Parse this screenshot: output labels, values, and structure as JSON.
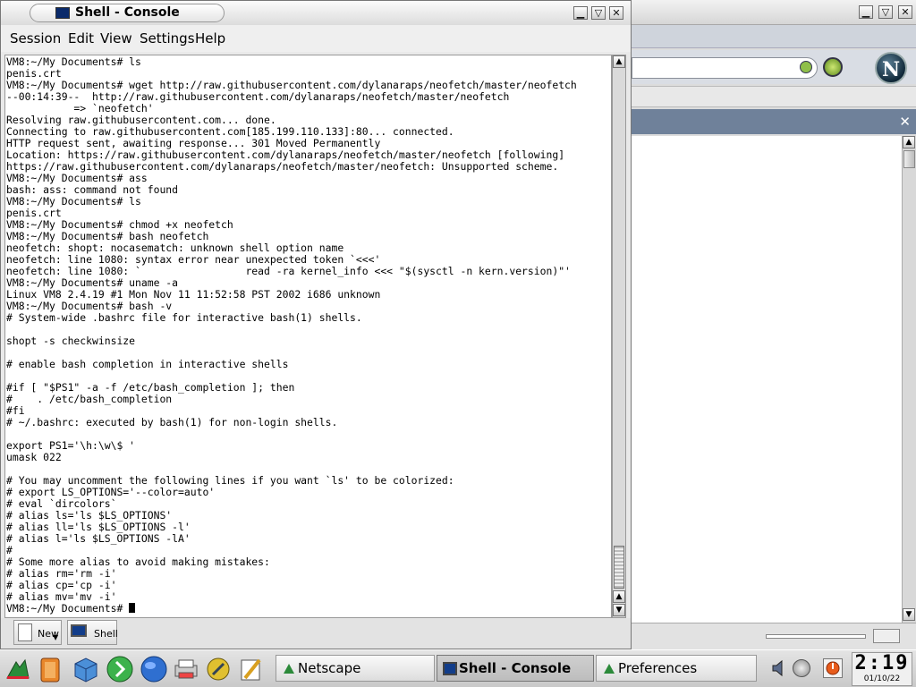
{
  "console_window": {
    "title": "Shell - Console",
    "menu": [
      "Session",
      "Edit",
      "View",
      "Settings",
      "Help"
    ],
    "terminal_lines": [
      "VM8:~/My Documents# ls",
      "penis.crt",
      "VM8:~/My Documents# wget http://raw.githubusercontent.com/dylanaraps/neofetch/master/neofetch",
      "--00:14:39--  http://raw.githubusercontent.com/dylanaraps/neofetch/master/neofetch",
      "           => `neofetch'",
      "Resolving raw.githubusercontent.com... done.",
      "Connecting to raw.githubusercontent.com[185.199.110.133]:80... connected.",
      "HTTP request sent, awaiting response... 301 Moved Permanently",
      "Location: https://raw.githubusercontent.com/dylanaraps/neofetch/master/neofetch [following]",
      "https://raw.githubusercontent.com/dylanaraps/neofetch/master/neofetch: Unsupported scheme.",
      "VM8:~/My Documents# ass",
      "bash: ass: command not found",
      "VM8:~/My Documents# ls",
      "penis.crt",
      "VM8:~/My Documents# chmod +x neofetch",
      "VM8:~/My Documents# bash neofetch",
      "neofetch: shopt: nocasematch: unknown shell option name",
      "neofetch: line 1080: syntax error near unexpected token `<<<'",
      "neofetch: line 1080: `                 read -ra kernel_info <<< \"$(sysctl -n kern.version)\"'",
      "VM8:~/My Documents# uname -a",
      "Linux VM8 2.4.19 #1 Mon Nov 11 11:52:58 PST 2002 i686 unknown",
      "VM8:~/My Documents# bash -v",
      "# System-wide .bashrc file for interactive bash(1) shells.",
      "",
      "shopt -s checkwinsize",
      "",
      "# enable bash completion in interactive shells",
      "",
      "#if [ \"$PS1\" -a -f /etc/bash_completion ]; then",
      "#    . /etc/bash_completion",
      "#fi",
      "# ~/.bashrc: executed by bash(1) for non-login shells.",
      "",
      "export PS1='\\h:\\w\\$ '",
      "umask 022",
      "",
      "# You may uncomment the following lines if you want `ls' to be colorized:",
      "# export LS_OPTIONS='--color=auto'",
      "# eval `dircolors`",
      "# alias ls='ls $LS_OPTIONS'",
      "# alias ll='ls $LS_OPTIONS -l'",
      "# alias l='ls $LS_OPTIONS -lA'",
      "#",
      "# Some more alias to avoid making mistakes:",
      "# alias rm='rm -i'",
      "# alias cp='cp -i'",
      "# alias mv='mv -i'"
    ],
    "prompt": "VM8:~/My Documents# ",
    "tabs": [
      {
        "label": "New",
        "icon": "new-document-icon"
      },
      {
        "label": "Shell",
        "icon": "terminal-icon"
      }
    ]
  },
  "taskbar": {
    "launchers": [
      "kde-menu-icon",
      "lifebuoy-help-icon",
      "home-cube-icon",
      "runner-icon",
      "globe-icon",
      "printer-icon",
      "tools-icon",
      "editor-icon"
    ],
    "tasks": [
      {
        "label": "Netscape",
        "icon": "netscape-icon"
      },
      {
        "label": "Shell - Console",
        "icon": "terminal-icon"
      },
      {
        "label": "Preferences",
        "icon": "netscape-icon"
      }
    ],
    "clock": {
      "time": "2:19",
      "date": "01/10/22"
    }
  },
  "background_window": {
    "app": "Netscape",
    "logo_letter": "N"
  },
  "colors": {
    "terminal_bg": "#ffffff",
    "terminal_fg": "#000000",
    "sidebar_header": "#6f819a",
    "window_chrome": "#dcdcdc"
  }
}
